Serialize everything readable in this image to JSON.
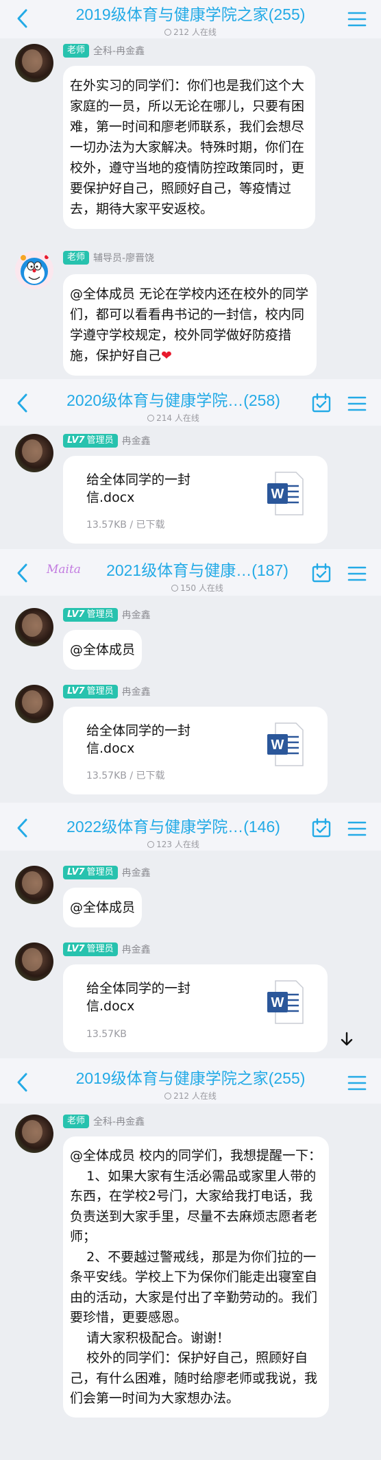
{
  "colors": {
    "accent": "#23aae6",
    "badge": "#27c2ae",
    "word_blue": "#2b579a"
  },
  "s1": {
    "header": {
      "title": "2019级体育与健康学院之家(255)",
      "online": "212 人在线"
    },
    "msg1": {
      "badge": "老师",
      "name": "全科-冉金鑫",
      "text": "在外实习的同学们：你们也是我们这个大家庭的一员，所以无论在哪儿，只要有困难，第一时间和廖老师联系，我们会想尽一切办法为大家解决。特殊时期，你们在校外，遵守当地的疫情防控政策同时，更要保护好自己，照顾好自己，等疫情过去，期待大家平安返校。"
    },
    "msg2": {
      "badge": "老师",
      "name": "辅导员-廖晋饶",
      "text": "@全体成员 无论在学校内还在校外的同学们，都可以看看冉书记的一封信，校内同学遵守学校规定，校外同学做好防疫措施，保护好自己"
    }
  },
  "s2": {
    "header": {
      "title": "2020级体育与健康学院…(258)",
      "online": "214 人在线"
    },
    "msg1": {
      "lv": "LV7",
      "badge": "管理员",
      "name": "冉金鑫",
      "file_name": "给全体同学的一封信.docx",
      "file_size": "13.57KB / 已下载"
    }
  },
  "s3": {
    "header": {
      "logo": "Maita",
      "title": "2021级体育与健康…(187)",
      "online": "150 人在线"
    },
    "msg1": {
      "lv": "LV7",
      "badge": "管理员",
      "name": "冉金鑫",
      "text": "@全体成员"
    },
    "msg2": {
      "lv": "LV7",
      "badge": "管理员",
      "name": "冉金鑫",
      "file_name": "给全体同学的一封信.docx",
      "file_size": "13.57KB / 已下载"
    }
  },
  "s4": {
    "header": {
      "title": "2022级体育与健康学院…(146)",
      "online": "123 人在线"
    },
    "msg1": {
      "lv": "LV7",
      "badge": "管理员",
      "name": "冉金鑫",
      "text": "@全体成员"
    },
    "msg2": {
      "lv": "LV7",
      "badge": "管理员",
      "name": "冉金鑫",
      "file_name": "给全体同学的一封信.docx",
      "file_size": "13.57KB"
    }
  },
  "s5": {
    "header": {
      "title": "2019级体育与健康学院之家(255)",
      "online": "212 人在线"
    },
    "msg1": {
      "badge": "老师",
      "name": "全科-冉金鑫",
      "text": "@全体成员 校内的同学们，我想提醒一下：\n    1、如果大家有生活必需品或家里人带的东西，在学校2号门，大家给我打电话，我负责送到大家手里，尽量不去麻烦志愿者老师；\n    2、不要越过警戒线，那是为你们拉的一条平安线。学校上下为保你们能走出寝室自由的活动，大家是付出了辛勤劳动的。我们要珍惜，更要感恩。\n    请大家积极配合。谢谢！\n    校外的同学们：保护好自己，照顾好自己，有什么困难，随时给廖老师或我说，我们会第一时间为大家想办法。"
    }
  }
}
